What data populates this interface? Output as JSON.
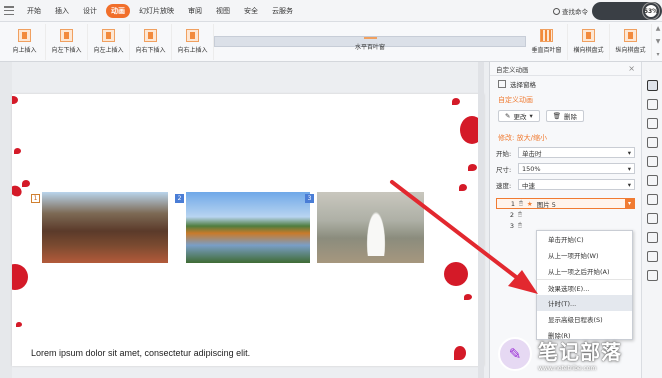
{
  "menu": {
    "tabs": [
      "开始",
      "插入",
      "设计",
      "动画",
      "幻灯片放映",
      "审阅",
      "视图",
      "安全",
      "云服务"
    ],
    "active_tab": "动画",
    "search_label": "查找命令",
    "net_badge": "53%"
  },
  "ribbon": {
    "effects": [
      "向上插入",
      "向左下插入",
      "向左上插入",
      "向右下插入",
      "向右上插入",
      "水平百叶窗",
      "垂直百叶窗",
      "横向棋盘式",
      "纵向棋盘式"
    ],
    "selected": "水平百叶窗"
  },
  "slide": {
    "badges": [
      "1",
      "2",
      "3"
    ],
    "body_text": "Lorem ipsum dolor sit amet, consectetur adipiscing elit."
  },
  "panel": {
    "title": "自定义动画",
    "select_pane": "选择窗格",
    "section_title": "自定义动画",
    "change_btn": "更改",
    "delete_btn": "删除",
    "modify_label": "修改: 放大/缩小",
    "start_label": "开始:",
    "start_value": "单击时",
    "size_label": "尺寸:",
    "size_value": "150%",
    "speed_label": "速度:",
    "speed_value": "中速",
    "list": [
      {
        "num": "1",
        "name": "图片 5"
      },
      {
        "num": "2",
        "name": ""
      },
      {
        "num": "3",
        "name": ""
      }
    ]
  },
  "context_menu": {
    "items": [
      "单击开始(C)",
      "从上一项开始(W)",
      "从上一项之后开始(A)",
      "效果选项(E)...",
      "计时(T)...",
      "显示高级日程表(S)",
      "删除(R)"
    ],
    "highlighted": "计时(T)..."
  },
  "watermark": {
    "title": "笔记部落",
    "url": "www.notetribe.com"
  },
  "colors": {
    "accent": "#f16f2b",
    "arrow": "#e2282f"
  }
}
